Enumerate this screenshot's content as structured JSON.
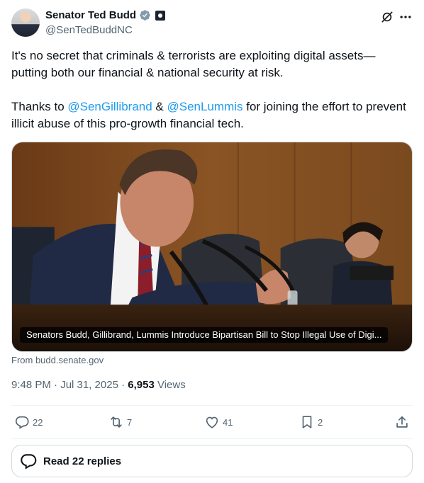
{
  "author": {
    "display_name": "Senator Ted Budd",
    "handle": "@SenTedBuddNC"
  },
  "tweet": {
    "line1": "It's no secret that criminals & terrorists are exploiting digital assets—putting both our financial & national security at risk.",
    "thanks_prefix": "Thanks to ",
    "mention1": "@SenGillibrand",
    "and_text": " & ",
    "mention2": "@SenLummis",
    "thanks_suffix": " for joining the effort to prevent illicit abuse of this pro-growth financial tech."
  },
  "card": {
    "caption": "Senators Budd, Gillibrand, Lummis Introduce Bipartisan Bill to Stop Illegal Use of Digi...",
    "source": "From budd.senate.gov"
  },
  "meta": {
    "timestamp": "9:48 PM · Jul 31, 2025 · ",
    "views_count": "6,953",
    "views_label": " Views"
  },
  "actions": {
    "replies": "22",
    "reposts": "7",
    "likes": "41",
    "bookmarks": "2"
  },
  "read_replies_label": "Read 22 replies",
  "colors": {
    "accent": "#1d9bf0",
    "secondary_text": "#536471",
    "primary_text": "#0f1419"
  }
}
